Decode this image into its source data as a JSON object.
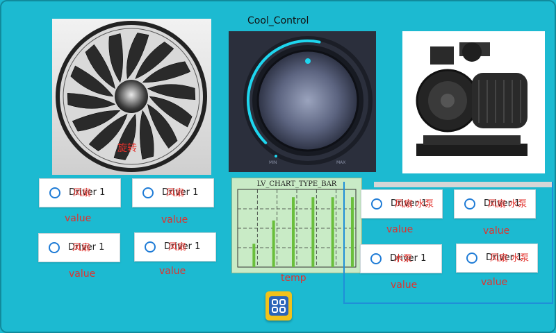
{
  "knob": {
    "title": "Cool_Control",
    "min_label": "MIN",
    "max_label": "MAX",
    "level": 0.35
  },
  "fan": {
    "overlay": "旋转"
  },
  "drivers": [
    {
      "label": "Driver 1",
      "overlay": "风扇",
      "value": "value"
    },
    {
      "label": "Driver 1",
      "overlay": "风扇",
      "value": "value"
    },
    {
      "label": "Driver 1",
      "overlay": "风扇",
      "value": "value"
    },
    {
      "label": "Driver 1",
      "overlay": "风扇",
      "value": "value"
    },
    {
      "label": "Driver 1",
      "overlay": "风扇 水泵",
      "value": "value"
    },
    {
      "label": "Driver 1",
      "overlay": "风扇 水泵",
      "value": "value"
    },
    {
      "label": "Driver 1",
      "overlay": "水泵",
      "value": "value"
    },
    {
      "label": "Driver 1",
      "overlay": "风扇 水泵",
      "value": "value"
    }
  ],
  "chart_data": {
    "type": "bar",
    "title": "LV_CHART_TYPE_BAR",
    "xlabel": "temp",
    "values": [
      30,
      60,
      90,
      90,
      90,
      90
    ],
    "ylim": [
      0,
      100
    ],
    "grid": true,
    "colors": [
      "#6abf3c"
    ]
  },
  "colors": {
    "background": "#1cbad1",
    "accent": "#1e7bd6",
    "label_red": "#e2312c"
  }
}
